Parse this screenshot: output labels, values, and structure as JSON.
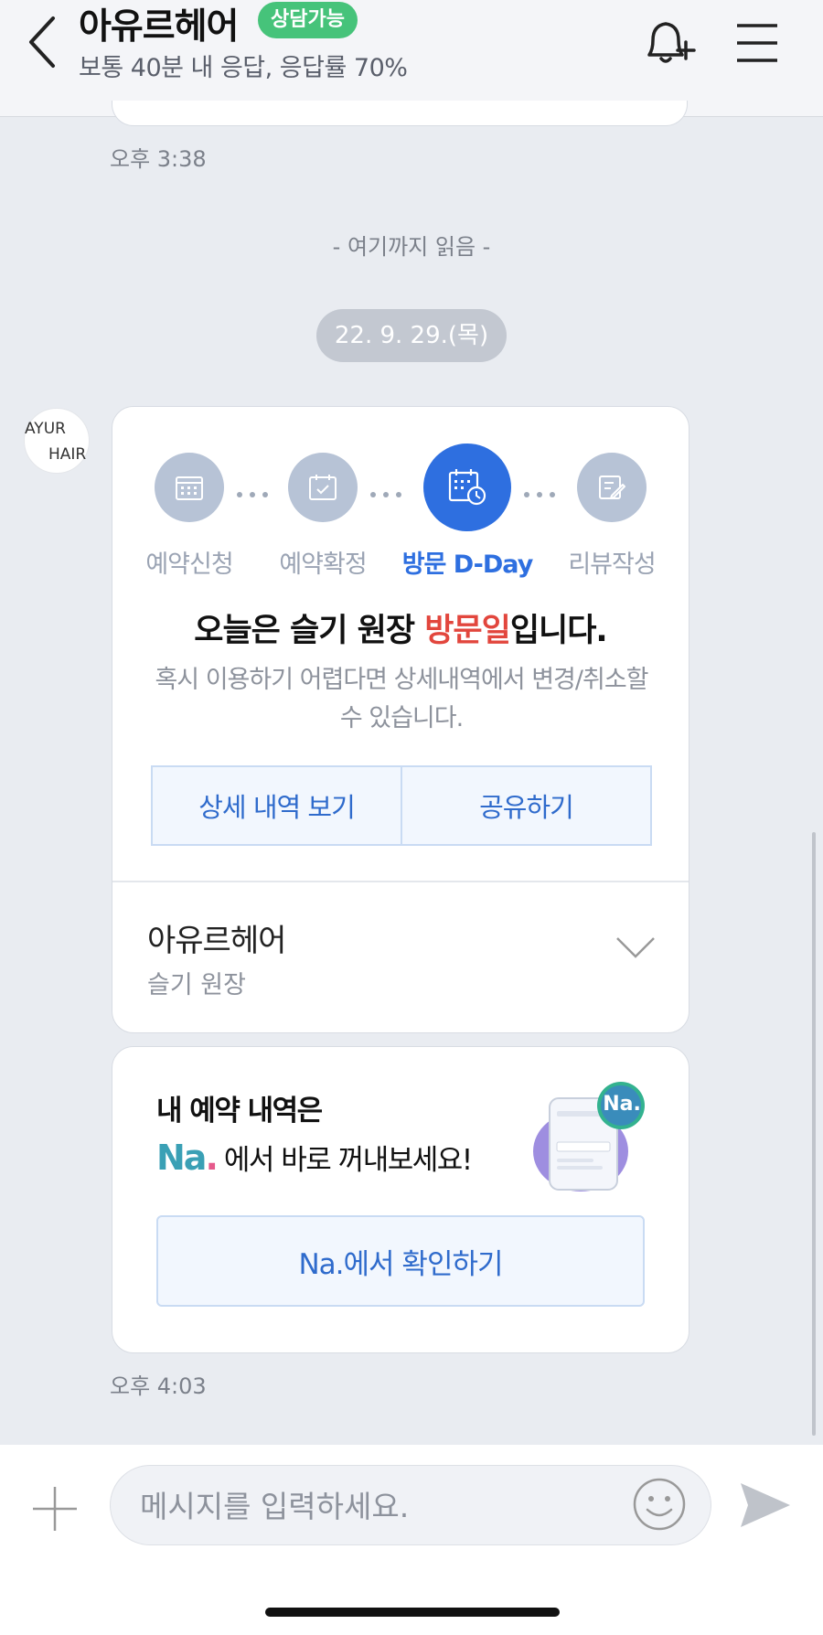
{
  "header": {
    "title": "아유르헤어",
    "status_badge": "상담가능",
    "subtitle": "보통 40분 내 응답, 응답률 70%"
  },
  "chat": {
    "prev_time": "오후 3:38",
    "read_marker": "- 여기까지 읽음 -",
    "date": "22. 9. 29.(목)",
    "avatar_line1": "AYUR",
    "avatar_line2": "HAIR",
    "booking_card": {
      "steps": [
        {
          "label": "예약신청",
          "active": false,
          "icon": "calendar-grid-icon"
        },
        {
          "label": "예약확정",
          "active": false,
          "icon": "calendar-check-icon"
        },
        {
          "label": "방문 D-Day",
          "active": true,
          "icon": "calendar-clock-icon"
        },
        {
          "label": "리뷰작성",
          "active": false,
          "icon": "pencil-note-icon"
        }
      ],
      "headline_pre": "오늘은 슬기 원장 ",
      "headline_highlight": "방문일",
      "headline_post": "입니다.",
      "description": "혹시 이용하기 어렵다면 상세내역에서 변경/취소할 수 있습니다.",
      "detail_button": "상세 내역 보기",
      "share_button": "공유하기",
      "shop_name": "아유르헤어",
      "designer": "슬기 원장"
    },
    "promo_card": {
      "line1": "내 예약 내역은",
      "logo_text": "Na",
      "logo_dot": ".",
      "line2": "에서 바로 꺼내보세요!",
      "badge": "Na.",
      "button": "Na.에서 확인하기"
    },
    "last_time": "오후 4:03"
  },
  "input_bar": {
    "placeholder": "메시지를 입력하세요."
  },
  "colors": {
    "accent_blue": "#2e6fe0",
    "highlight_red": "#e2463d",
    "status_green": "#46c37a"
  }
}
